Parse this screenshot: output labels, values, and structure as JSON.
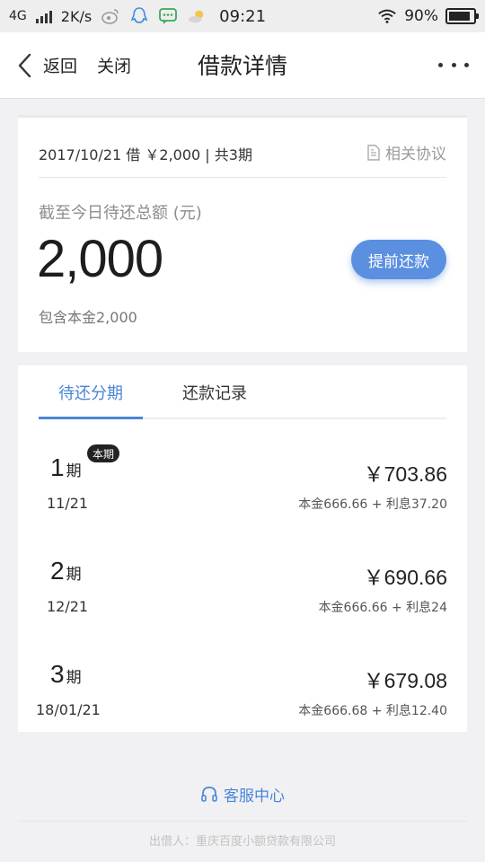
{
  "statusbar": {
    "network": "4G",
    "speed": "2K/s",
    "time": "09:21",
    "battery": "90%",
    "battery_level": 0.9
  },
  "nav": {
    "back_label": "返回",
    "close_label": "关闭",
    "title": "借款详情"
  },
  "summary": {
    "loan_info": "2017/10/21 借 ￥2,000 | 共3期",
    "agreement_label": "相关协议",
    "due_label": "截至今日待还总额 (元)",
    "due_amount": "2,000",
    "prepay_label": "提前还款",
    "principal_note": "包含本金2,000"
  },
  "tabs": {
    "pending": "待还分期",
    "records": "还款记录"
  },
  "periods": [
    {
      "num": "1",
      "unit": "期",
      "badge": "本期",
      "date": "11/21",
      "amount": "￥703.86",
      "detail": "本金666.66 + 利息37.20"
    },
    {
      "num": "2",
      "unit": "期",
      "date": "12/21",
      "amount": "￥690.66",
      "detail": "本金666.66 + 利息24"
    },
    {
      "num": "3",
      "unit": "期",
      "date": "18/01/21",
      "amount": "￥679.08",
      "detail": "本金666.68 + 利息12.40"
    }
  ],
  "service_label": "客服中心",
  "lender": "出借人：重庆百度小额贷款有限公司",
  "colors": {
    "accent": "#4a86d8",
    "button": "#5b8fe0"
  }
}
